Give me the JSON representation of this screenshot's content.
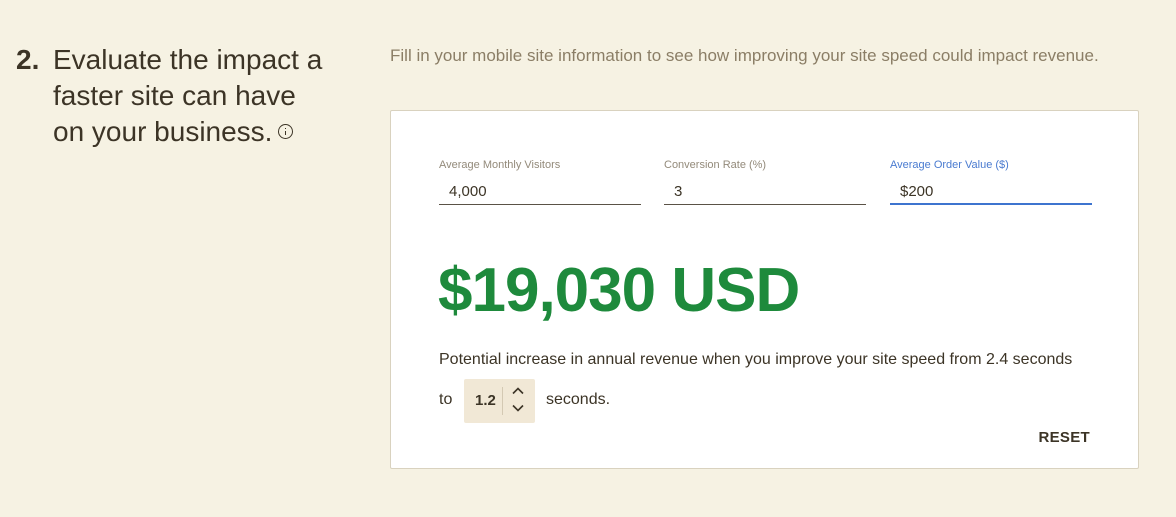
{
  "step": {
    "number": "2.",
    "title": "Evaluate the impact a faster site can have on your business.",
    "info_icon": "info-circle-icon"
  },
  "intro": "Fill in your mobile site information to see how improving your site speed could impact revenue.",
  "calculator": {
    "fields": [
      {
        "label": "Average Monthly Visitors",
        "value": "4,000"
      },
      {
        "label": "Conversion Rate (%)",
        "value": "3"
      },
      {
        "label": "Average Order Value ($)",
        "value": "$200"
      }
    ],
    "result_amount": "$19,030 USD",
    "result_description": "Potential increase in annual revenue when you improve your site speed from 2.4 seconds",
    "to_label": "to",
    "target_speed": "1.2",
    "seconds_label": "seconds.",
    "reset_label": "RESET"
  },
  "colors": {
    "background": "#f6f2e3",
    "accent_green": "#1e8a3c",
    "focus_blue": "#3d74cf",
    "stepper_bg": "#f1e8d6"
  }
}
